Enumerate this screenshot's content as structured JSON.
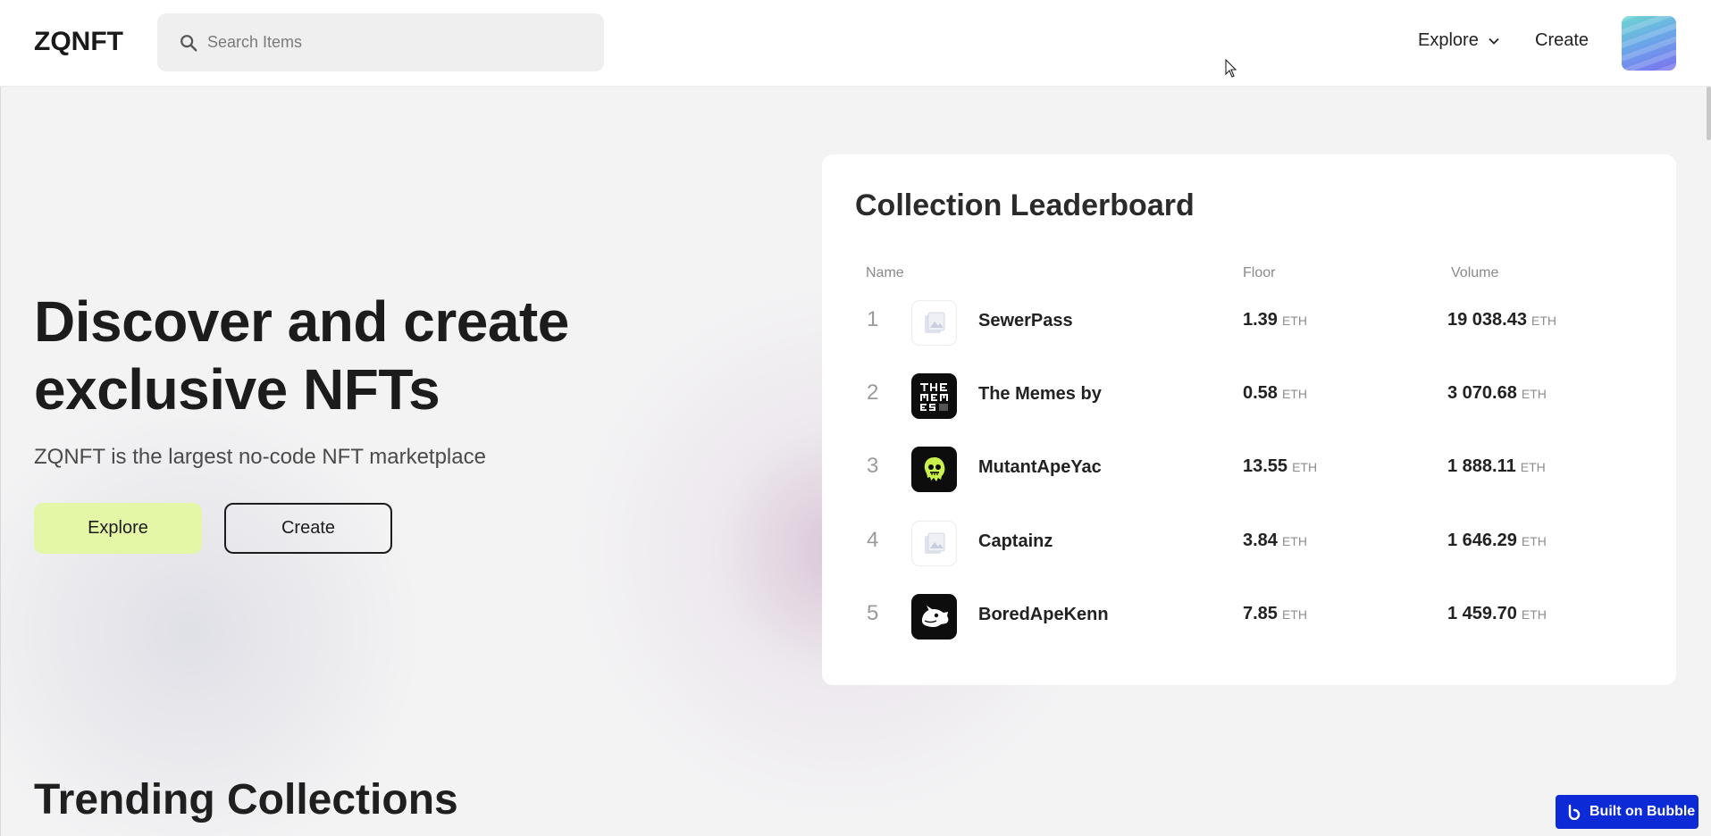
{
  "header": {
    "logo": "ZQNFT",
    "search": {
      "placeholder": "Search Items",
      "icon": "search-icon"
    },
    "nav": {
      "explore_label": "Explore",
      "create_label": "Create"
    }
  },
  "hero": {
    "title_line1": "Discover and create",
    "title_line2_a": "exclusive",
    "title_line2_b": "NFTs",
    "subtitle": "ZQNFT is the largest no-code NFT marketplace",
    "explore_button": "Explore",
    "create_button": "Create",
    "highlight_color": "#dff5a6"
  },
  "leaderboard": {
    "title": "Collection Leaderboard",
    "columns": {
      "name": "Name",
      "floor": "Floor",
      "volume": "Volume"
    },
    "unit": "ETH",
    "rows": [
      {
        "rank": "1",
        "name": "SewerPass",
        "floor": "1.39",
        "volume": "19 038.43",
        "thumb": "placeholder"
      },
      {
        "rank": "2",
        "name": "The Memes by",
        "floor": "0.58",
        "volume": "3 070.68",
        "thumb": "memes"
      },
      {
        "rank": "3",
        "name": "MutantApeYac",
        "floor": "13.55",
        "volume": "1 888.11",
        "thumb": "mutant"
      },
      {
        "rank": "4",
        "name": "Captainz",
        "floor": "3.84",
        "volume": "1 646.29",
        "thumb": "placeholder"
      },
      {
        "rank": "5",
        "name": "BoredApeKenn",
        "floor": "7.85",
        "volume": "1 459.70",
        "thumb": "dog"
      }
    ]
  },
  "trending": {
    "title": "Trending Collections"
  },
  "badge": {
    "label": "Built on Bubble"
  },
  "colors": {
    "accent": "#e3f7a7",
    "badge": "#0c2bd6"
  }
}
